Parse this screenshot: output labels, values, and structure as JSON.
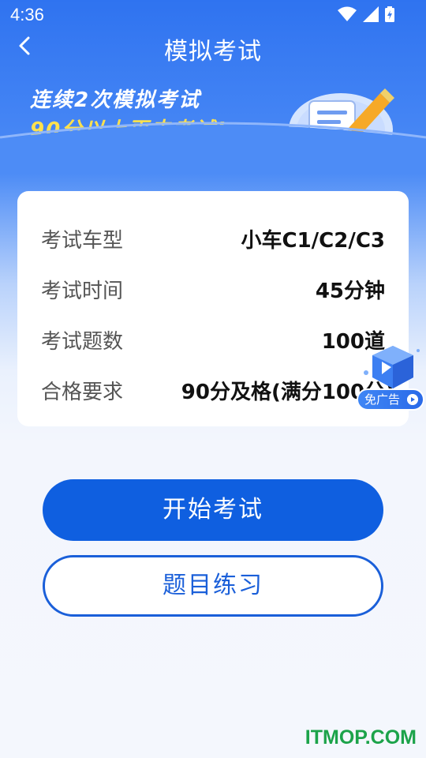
{
  "status": {
    "time": "4:36"
  },
  "header": {
    "title": "模拟考试"
  },
  "banner": {
    "line1": "连续2次模拟考试",
    "line2": "90分以上再去考试!"
  },
  "exam_info": [
    {
      "label": "考试车型",
      "value": "小车C1/C2/C3"
    },
    {
      "label": "考试时间",
      "value": "45分钟"
    },
    {
      "label": "考试题数",
      "value": "100道"
    },
    {
      "label": "合格要求",
      "value": "90分及格(满分100分)"
    }
  ],
  "ad": {
    "label": "免广告"
  },
  "actions": {
    "start_exam": "开始考试",
    "practice": "题目练习"
  },
  "watermark": "ITMOP.COM",
  "colors": {
    "primary": "#0f5fe0",
    "banner_highlight": "#ffe14d",
    "watermark": "#1ca34a"
  }
}
